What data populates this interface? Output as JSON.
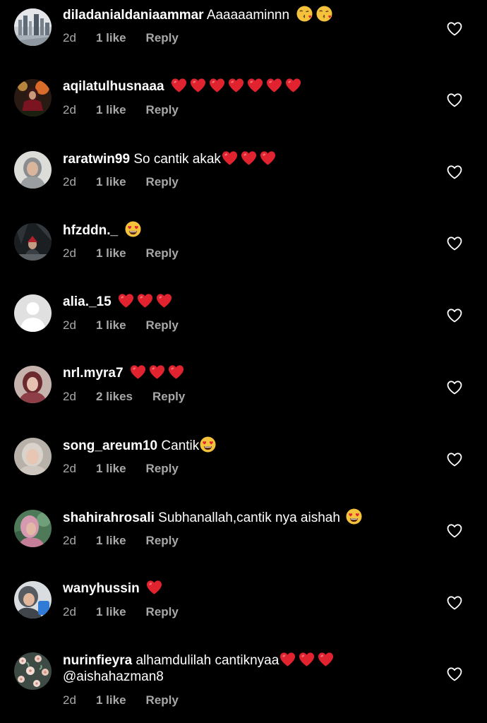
{
  "colors": {
    "background": "#000000",
    "text": "#ffffff",
    "meta": "#a8a8a8",
    "heart_emoji": "#e0232f",
    "face_emoji": "#f5c33b"
  },
  "comments": [
    {
      "username": "diladanialdaniaammar",
      "text": "Aaaaaaminnn",
      "emojis": [
        "kissing-heart-emoji",
        "kissing-heart-emoji"
      ],
      "time": "2d",
      "likes": "1 like",
      "reply": "Reply"
    },
    {
      "username": "aqilatulhusnaaa",
      "text": "",
      "emojis": [
        "red-heart-emoji",
        "red-heart-emoji",
        "red-heart-emoji",
        "red-heart-emoji",
        "red-heart-emoji",
        "red-heart-emoji",
        "red-heart-emoji"
      ],
      "time": "2d",
      "likes": "1 like",
      "reply": "Reply"
    },
    {
      "username": "raratwin99",
      "text": "So cantik akak",
      "emojis": [
        "red-heart-emoji",
        "red-heart-emoji",
        "red-heart-emoji"
      ],
      "time": "2d",
      "likes": "1 like",
      "reply": "Reply"
    },
    {
      "username": "hfzddn._",
      "text": "",
      "emojis": [
        "heart-eyes-emoji"
      ],
      "time": "2d",
      "likes": "1 like",
      "reply": "Reply"
    },
    {
      "username": "alia._15",
      "text": "",
      "emojis": [
        "red-heart-emoji",
        "red-heart-emoji",
        "red-heart-emoji"
      ],
      "time": "2d",
      "likes": "1 like",
      "reply": "Reply"
    },
    {
      "username": "nrl.myra7",
      "text": "",
      "emojis": [
        "red-heart-emoji",
        "red-heart-emoji",
        "red-heart-emoji"
      ],
      "time": "2d",
      "likes": "2 likes",
      "reply": "Reply"
    },
    {
      "username": "song_areum10",
      "text": "Cantik",
      "emojis": [
        "heart-eyes-emoji"
      ],
      "time": "2d",
      "likes": "1 like",
      "reply": "Reply"
    },
    {
      "username": "shahirahrosali",
      "text": "Subhanallah,cantik nya aishah",
      "emojis": [
        "heart-eyes-emoji"
      ],
      "time": "2d",
      "likes": "1 like",
      "reply": "Reply"
    },
    {
      "username": "wanyhussin",
      "text": "",
      "emojis": [
        "red-heart-emoji"
      ],
      "time": "2d",
      "likes": "1 like",
      "reply": "Reply"
    },
    {
      "username": "nurinfieyra",
      "text": "alhamdulilah cantiknyaa",
      "emojis": [
        "red-heart-emoji",
        "red-heart-emoji",
        "red-heart-emoji"
      ],
      "text_line2": "@aishahazman8",
      "time": "2d",
      "likes": "1 like",
      "reply": "Reply"
    }
  ]
}
